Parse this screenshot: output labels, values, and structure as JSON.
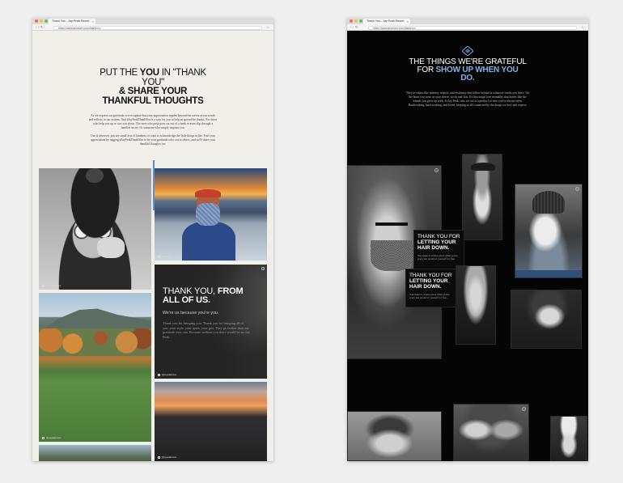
{
  "left_window": {
    "tab_title": "Thank You - Jay Peak Resort",
    "url": "https://jaypeakresort.com/thankyou",
    "hero": {
      "line1_pre": "PUT THE ",
      "line1_em": "YOU",
      "line1_post": " IN \"THANK",
      "line2": "YOU\"",
      "line3": "& SHARE YOUR",
      "line4": "THANKFUL THOUGHTS"
    },
    "body_p1": "As we express our gratitude, we recognize that your appreciation ripples beyond the waves of our words and reflects in our actions. And #JayPeakThankYou is a way for you to help us spread the thanks. For those who help you up or cars you down. The ones who push your car out of a bank or even slip through a familiar secret. Or someone who simply inspires you.",
    "body_p2": "Use it wherever you see small acts of kindness or want to acknowledge the little things in life. Post your appreciation by tagging #JayPeakThankYou to let your gratitude echo out to others, and we'll share your thankful thoughts too.",
    "tile_thankyou": {
      "title_pre": "THANK YOU, ",
      "title_em": "FROM",
      "title_line2": "ALL OF US.",
      "sub": "We're us because you're you.",
      "body": "Thank you for bringing you. Thank you for bringing all of you: your style, your spirit, your grit. They go farther than our gratitude ever can. Because without you there would be no Jay Peak."
    },
    "captions": [
      "@jaypeakresort",
      "@skiday",
      "@jaypeakresort",
      "@jaypeakresort",
      "@jaypeakresort"
    ]
  },
  "right_window": {
    "tab_title": "Thank You - Jay Peak Resort",
    "url": "https://jaypeakresort.com/thankyou",
    "hero": {
      "line1": "THE THINGS WE'RE GRATEFUL",
      "line2_pre": "FOR ",
      "line2_em": "SHOW UP WHEN YOU",
      "line3_em": "DO."
    },
    "body": "They're values like honesty, respect, and resilience that follow behind in whatever tracks you leave. On the heart you wear on your sleeve, socks and skis. It's that tough love mentality that leaves like the friends you grew up with. At Jay Peak, who we are is a product of who you've always been. Hardworking, hard working, and loved; keeping us all connected by the things we love and respect.",
    "quote1": {
      "title_pre": "THANK YOU FOR",
      "title_em": "LETTING YOUR HAIR DOWN.",
      "body": "You make it a better place when you're every last strand of yourself for free."
    },
    "quote2": {
      "title_pre": "THANK YOU FOR",
      "title_em": "LETTING YOUR HAIR DOWN.",
      "body": "You make it a better place when you're every last strand of yourself for free."
    }
  },
  "colors": {
    "accent_blue": "#7fb3e6",
    "left_bg": "#f0efea",
    "right_bg": "#050505"
  },
  "icons": [
    "back-icon",
    "forward-icon",
    "reload-icon",
    "star-icon",
    "close-icon",
    "expand-icon",
    "jay-peak-logo-icon"
  ]
}
